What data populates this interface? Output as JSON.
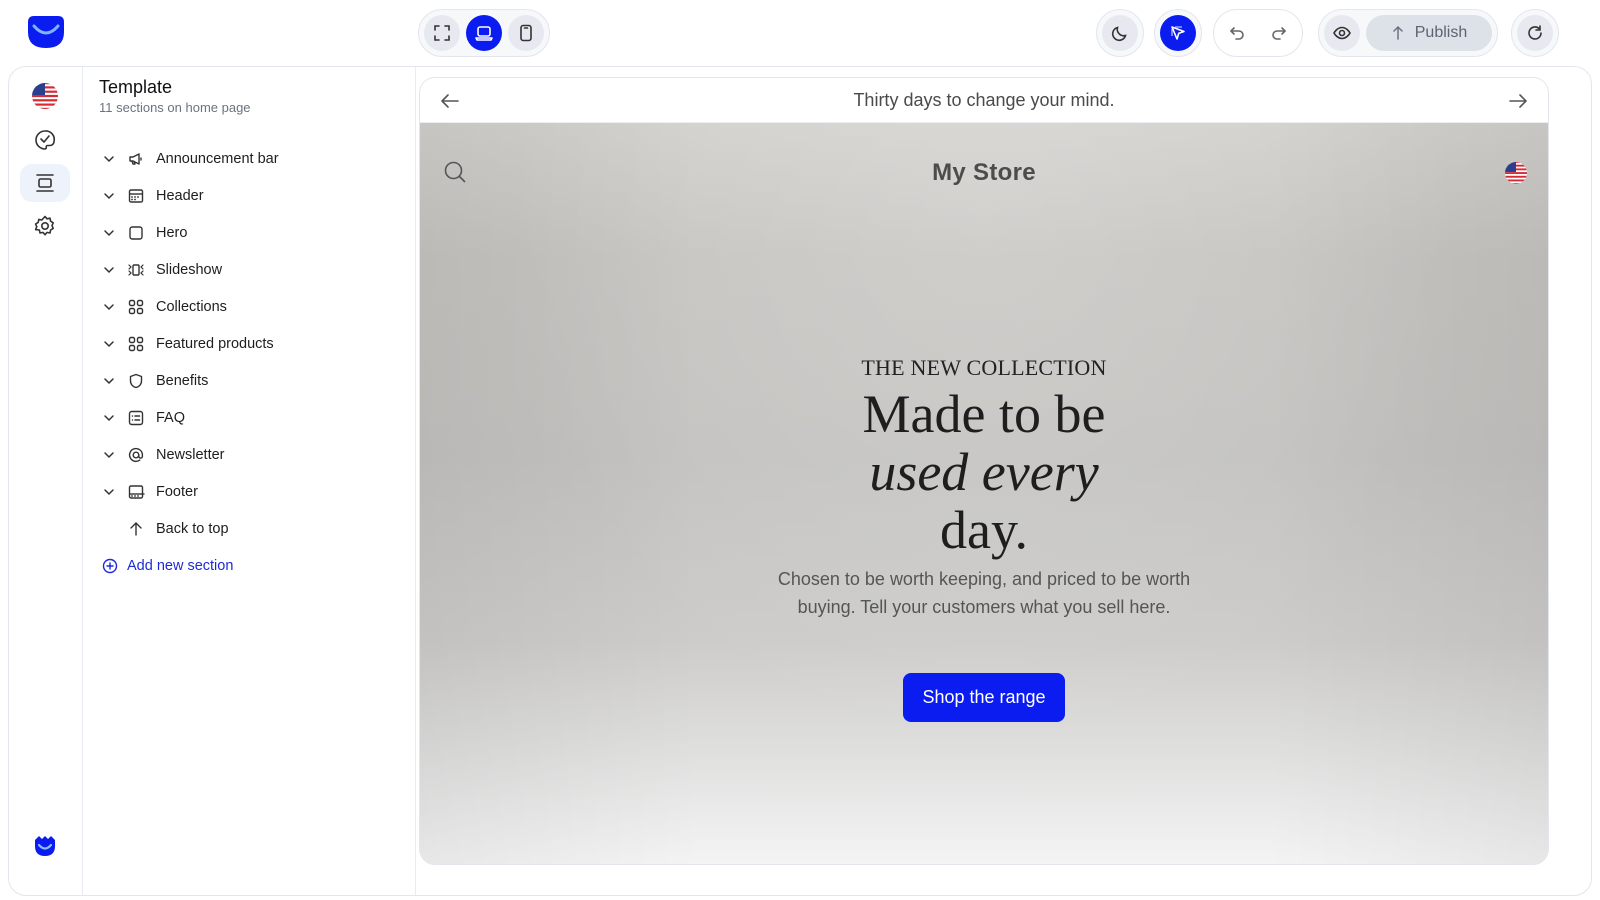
{
  "toolbar": {
    "device_group": [
      "fullscreen-icon",
      "laptop-icon",
      "mobile-icon"
    ],
    "active_device": "laptop",
    "publish_label": "Publish",
    "accent_color": "#0b1cf0"
  },
  "panel": {
    "title": "Template",
    "subtitle": "11 sections on home page",
    "sections": [
      {
        "label": "Announcement bar",
        "icon": "megaphone-icon"
      },
      {
        "label": "Header",
        "icon": "header-layout-icon"
      },
      {
        "label": "Hero",
        "icon": "square-icon"
      },
      {
        "label": "Slideshow",
        "icon": "slideshow-icon"
      },
      {
        "label": "Collections",
        "icon": "grid-icon"
      },
      {
        "label": "Featured products",
        "icon": "grid-icon"
      },
      {
        "label": "Benefits",
        "icon": "shield-icon"
      },
      {
        "label": "FAQ",
        "icon": "faq-icon"
      },
      {
        "label": "Newsletter",
        "icon": "at-sign-icon"
      },
      {
        "label": "Footer",
        "icon": "footer-layout-icon"
      },
      {
        "label": "Back to top",
        "icon": "arrow-up-icon"
      }
    ],
    "add_label": "Add new section"
  },
  "preview": {
    "announcement": "Thirty days to change your mind.",
    "store_name": "My Store",
    "hero": {
      "eyebrow": "THE NEW COLLECTION",
      "headline_1": "Made to be",
      "headline_2": "used every",
      "headline_3": "day.",
      "description": "Chosen to be worth keeping, and priced to be worth buying. Tell your customers what you sell here.",
      "cta": "Shop the range"
    }
  }
}
